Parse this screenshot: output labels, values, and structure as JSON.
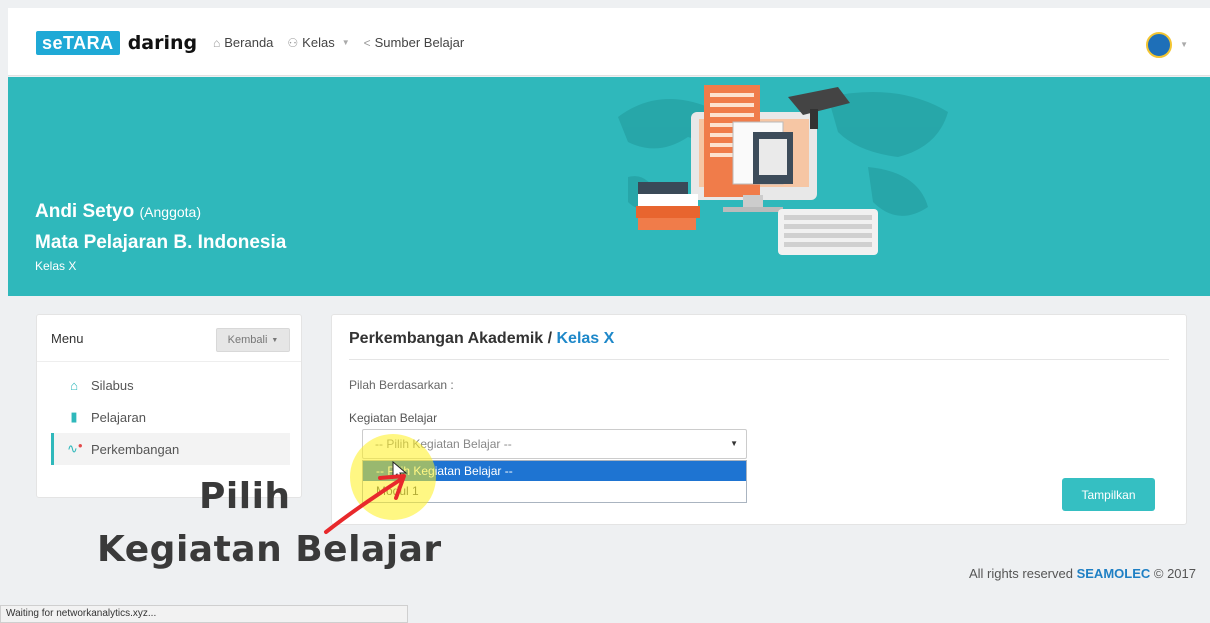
{
  "brand": {
    "logo_box": "seTARA",
    "logo_text": "daring"
  },
  "nav": {
    "items": [
      {
        "label": "Beranda",
        "icon": "home-icon"
      },
      {
        "label": "Kelas",
        "icon": "users-icon",
        "has_dropdown": true
      },
      {
        "label": "Sumber Belajar",
        "icon": "share-icon"
      }
    ]
  },
  "user": {
    "avatar_icon": "user-avatar-icon"
  },
  "banner": {
    "name": "Andi Setyo",
    "role": "(Anggota)",
    "subject": "Mata Pelajaran B. Indonesia",
    "class": "Kelas X"
  },
  "menu": {
    "title": "Menu",
    "back_label": "Kembali",
    "items": [
      {
        "label": "Silabus",
        "icon": "home-icon",
        "active": false
      },
      {
        "label": "Pelajaran",
        "icon": "book-icon",
        "active": false
      },
      {
        "label": "Perkembangan",
        "icon": "progress-icon",
        "active": true
      }
    ]
  },
  "main": {
    "title_prefix": "Perkembangan Akademik / ",
    "title_accent": "Kelas X",
    "filter_label": "Pilah Berdasarkan :",
    "field_label": "Kegiatan Belajar",
    "select_value": "-- Pilih Kegiatan Belajar --",
    "options": [
      "-- Pilih Kegiatan Belajar --",
      "Modul 1"
    ],
    "submit_label": "Tampilkan"
  },
  "annotation": {
    "line1": "Pilih",
    "line2": "Kegiatan Belajar"
  },
  "footer": {
    "prefix": "All rights reserved ",
    "brand": "SEAMOLEC",
    "suffix": " © 2017"
  },
  "statusbar": {
    "text": "Waiting for networkanalytics.xyz..."
  },
  "colors": {
    "teal": "#2fb8bb",
    "accent_blue": "#1e88c9",
    "selected_blue": "#1e74d2",
    "button_teal": "#35bfc2"
  }
}
